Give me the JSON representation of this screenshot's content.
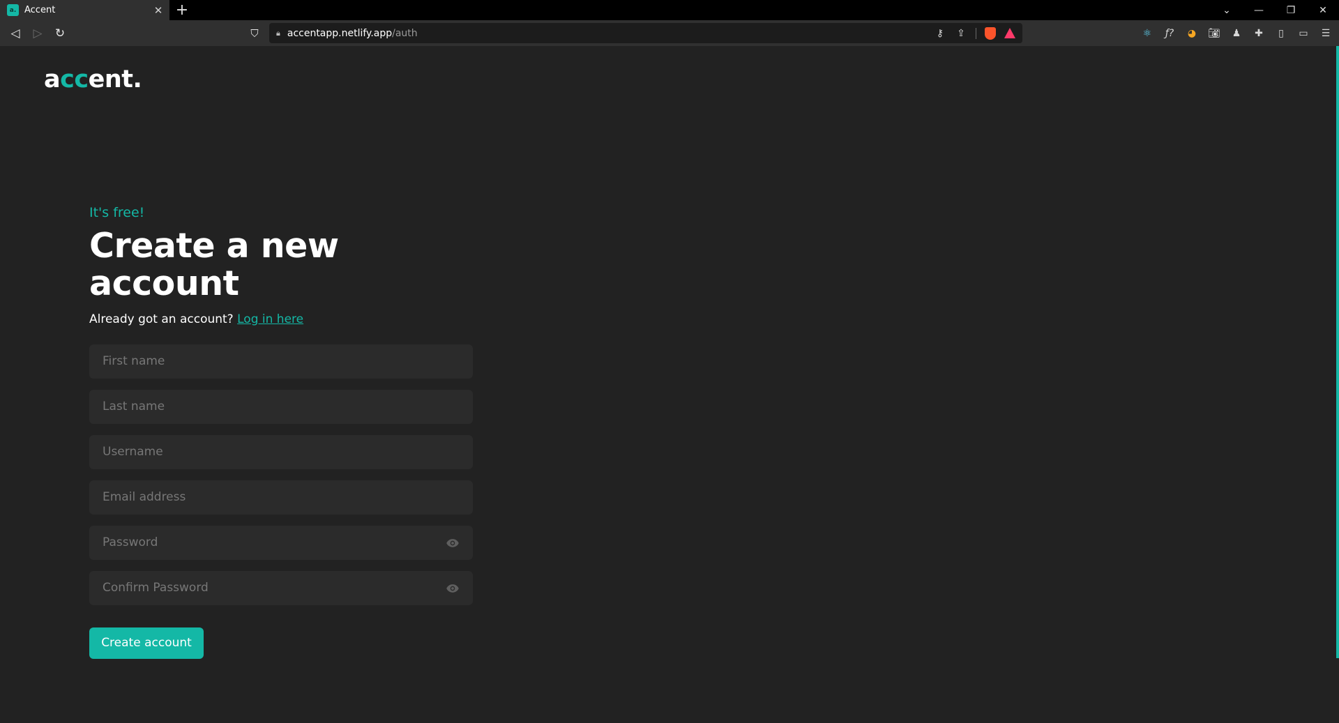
{
  "browser": {
    "tab": {
      "favicon_text": "a.",
      "title": "Accent"
    },
    "address": {
      "host": "accentapp.netlify.app",
      "path": "/auth"
    }
  },
  "colors": {
    "accent": "#14b8a6",
    "background": "#222222",
    "input_bg": "#2b2b2b"
  },
  "logo": {
    "part1": "a",
    "part2": "cc",
    "part3": "ent."
  },
  "form": {
    "eyebrow": "It's free!",
    "title": "Create a new account",
    "subtitle_text": "Already got an account? ",
    "login_link": "Log in here",
    "fields": {
      "first_name": "First name",
      "last_name": "Last name",
      "username": "Username",
      "email": "Email address",
      "password": "Password",
      "confirm_password": "Confirm Password"
    },
    "submit_label": "Create account"
  }
}
